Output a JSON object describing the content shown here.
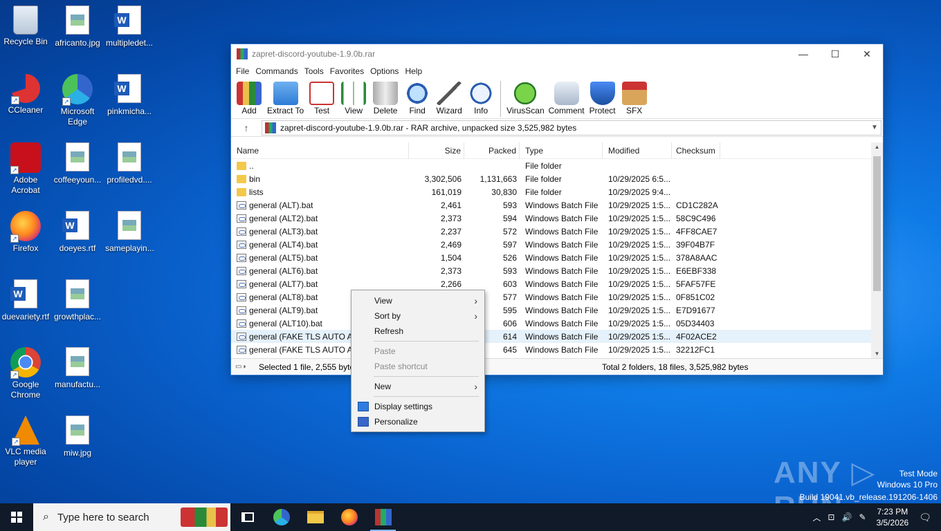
{
  "desktop": {
    "icons": [
      {
        "label": "Recycle Bin"
      },
      {
        "label": "africanto.jpg"
      },
      {
        "label": "multipledet..."
      },
      {
        "label": "CCleaner"
      },
      {
        "label": "Microsoft Edge"
      },
      {
        "label": "pinkmicha..."
      },
      {
        "label": "Adobe Acrobat"
      },
      {
        "label": "coffeeyoun..."
      },
      {
        "label": "profiledvd...."
      },
      {
        "label": "Firefox"
      },
      {
        "label": "doeyes.rtf"
      },
      {
        "label": "sameplayin..."
      },
      {
        "label": "duevariety.rtf"
      },
      {
        "label": "growthplac..."
      },
      {
        "label": "Google Chrome"
      },
      {
        "label": "manufactu..."
      },
      {
        "label": "VLC media player"
      },
      {
        "label": "miw.jpg"
      }
    ]
  },
  "window": {
    "title": "zapret-discord-youtube-1.9.0b.rar",
    "minimize": "—",
    "maximize": "☐",
    "close": "✕",
    "menu": [
      "File",
      "Commands",
      "Tools",
      "Favorites",
      "Options",
      "Help"
    ],
    "toolbar": [
      "Add",
      "Extract To",
      "Test",
      "View",
      "Delete",
      "Find",
      "Wizard",
      "Info",
      "VirusScan",
      "Comment",
      "Protect",
      "SFX"
    ],
    "up_arrow": "↑",
    "address": "zapret-discord-youtube-1.9.0b.rar - RAR archive, unpacked size 3,525,982 bytes",
    "columns": {
      "name": "Name",
      "size": "Size",
      "packed": "Packed",
      "type": "Type",
      "modified": "Modified",
      "checksum": "Checksum"
    },
    "rows": [
      {
        "name": "..",
        "size": "",
        "packed": "",
        "type": "File folder",
        "modified": "",
        "checksum": "",
        "kind": "folder"
      },
      {
        "name": "bin",
        "size": "3,302,506",
        "packed": "1,131,663",
        "type": "File folder",
        "modified": "10/29/2025 6:5...",
        "checksum": "",
        "kind": "folder"
      },
      {
        "name": "lists",
        "size": "161,019",
        "packed": "30,830",
        "type": "File folder",
        "modified": "10/29/2025 9:4...",
        "checksum": "",
        "kind": "folder"
      },
      {
        "name": "general (ALT).bat",
        "size": "2,461",
        "packed": "593",
        "type": "Windows Batch File",
        "modified": "10/29/2025 1:5...",
        "checksum": "CD1C282A",
        "kind": "bat"
      },
      {
        "name": "general (ALT2).bat",
        "size": "2,373",
        "packed": "594",
        "type": "Windows Batch File",
        "modified": "10/29/2025 1:5...",
        "checksum": "58C9C496",
        "kind": "bat"
      },
      {
        "name": "general (ALT3).bat",
        "size": "2,237",
        "packed": "572",
        "type": "Windows Batch File",
        "modified": "10/29/2025 1:5...",
        "checksum": "4FF8CAE7",
        "kind": "bat"
      },
      {
        "name": "general (ALT4).bat",
        "size": "2,469",
        "packed": "597",
        "type": "Windows Batch File",
        "modified": "10/29/2025 1:5...",
        "checksum": "39F04B7F",
        "kind": "bat"
      },
      {
        "name": "general (ALT5).bat",
        "size": "1,504",
        "packed": "526",
        "type": "Windows Batch File",
        "modified": "10/29/2025 1:5...",
        "checksum": "378A8AAC",
        "kind": "bat"
      },
      {
        "name": "general (ALT6).bat",
        "size": "2,373",
        "packed": "593",
        "type": "Windows Batch File",
        "modified": "10/29/2025 1:5...",
        "checksum": "E6EBF338",
        "kind": "bat"
      },
      {
        "name": "general (ALT7).bat",
        "size": "2,266",
        "packed": "603",
        "type": "Windows Batch File",
        "modified": "10/29/2025 1:5...",
        "checksum": "5FAF57FE",
        "kind": "bat"
      },
      {
        "name": "general (ALT8).bat",
        "size": "",
        "packed": "577",
        "type": "Windows Batch File",
        "modified": "10/29/2025 1:5...",
        "checksum": "0F851C02",
        "kind": "bat"
      },
      {
        "name": "general (ALT9).bat",
        "size": "",
        "packed": "595",
        "type": "Windows Batch File",
        "modified": "10/29/2025 1:5...",
        "checksum": "E7D91677",
        "kind": "bat"
      },
      {
        "name": "general (ALT10).bat",
        "size": "",
        "packed": "606",
        "type": "Windows Batch File",
        "modified": "10/29/2025 1:5...",
        "checksum": "05D34403",
        "kind": "bat"
      },
      {
        "name": "general (FAKE TLS AUTO ALT",
        "size": "",
        "packed": "614",
        "type": "Windows Batch File",
        "modified": "10/29/2025 1:5...",
        "checksum": "4F02ACE2",
        "kind": "bat",
        "selected": true
      },
      {
        "name": "general (FAKE TLS AUTO ALT",
        "size": "",
        "packed": "645",
        "type": "Windows Batch File",
        "modified": "10/29/2025 1:5...",
        "checksum": "32212FC1",
        "kind": "bat"
      }
    ],
    "status_left": "Selected 1 file, 2,555 byte",
    "status_right": "Total 2 folders, 18 files, 3,525,982 bytes"
  },
  "context_menu": {
    "view": "View",
    "sort_by": "Sort by",
    "refresh": "Refresh",
    "paste": "Paste",
    "paste_shortcut": "Paste shortcut",
    "new": "New",
    "display_settings": "Display settings",
    "personalize": "Personalize",
    "submenu_arrow": "›"
  },
  "watermark": {
    "brand": "ANY ▷ RUN",
    "line1": "Test Mode",
    "line2": "Windows 10 Pro",
    "line3": "Build 19041.vb_release.191206-1406"
  },
  "taskbar": {
    "search_placeholder": "Type here to search",
    "search_glyph": "⌕",
    "time": "7:23 PM",
    "date": "3/5/2026",
    "tray_chevron": "︿",
    "tray_network": "⊡",
    "tray_volume": "🔊",
    "tray_lang": "✎",
    "notifications": "🗨"
  }
}
